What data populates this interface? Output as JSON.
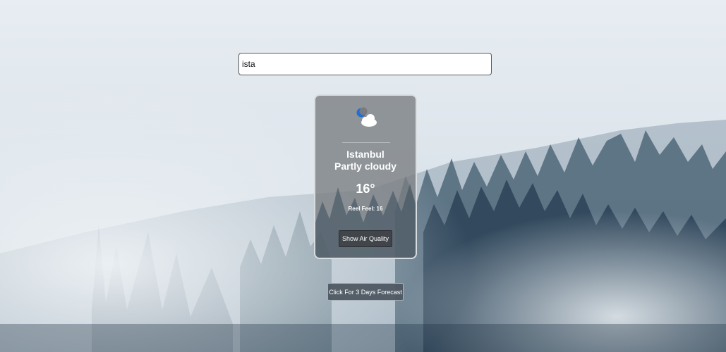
{
  "search": {
    "value": "ista"
  },
  "card": {
    "icon": "partly-cloudy-night-icon",
    "city": "Istanbul",
    "condition": "Partly cloudy",
    "temperature": "16°",
    "feel": "Reel Feel: 16",
    "air_quality_label": "Show Air Quality"
  },
  "forecast_button": {
    "label": "Click For 3 Days Forecast"
  },
  "colors": {
    "card_bg": "#787c80",
    "button_bg": "#3c4044",
    "moon": "#1e6fd6"
  }
}
